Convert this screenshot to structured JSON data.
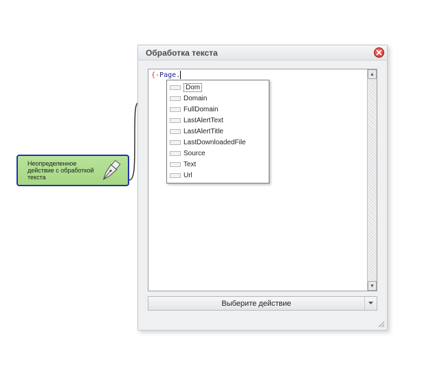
{
  "node": {
    "label": "Неопределенное действие с обработкой текста",
    "icon": "pen-nib-icon"
  },
  "dialog": {
    "title": "Обработка текста",
    "close_icon": "close-icon",
    "editor": {
      "brace": "{-",
      "code_text": "Page."
    },
    "autocomplete": {
      "items": [
        {
          "label": "Dom"
        },
        {
          "label": "Domain"
        },
        {
          "label": "FullDomain"
        },
        {
          "label": "LastAlertText"
        },
        {
          "label": "LastAlertTitle"
        },
        {
          "label": "LastDownloadedFile"
        },
        {
          "label": "Source"
        },
        {
          "label": "Text"
        },
        {
          "label": "Url"
        }
      ],
      "selected_index": 0
    },
    "action_select": {
      "value": "Выберите действие"
    }
  },
  "colors": {
    "node_fill": "#a9da86",
    "node_border": "#2233a8",
    "close_red": "#d9342c"
  }
}
